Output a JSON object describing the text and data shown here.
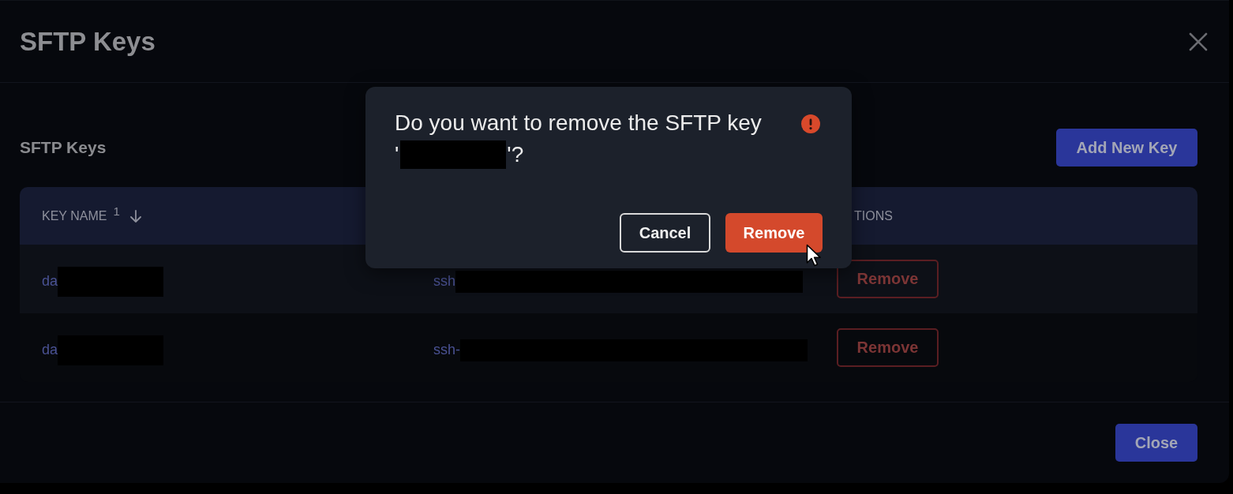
{
  "window": {
    "title": "SFTP Keys"
  },
  "section": {
    "title": "SFTP Keys",
    "add_button": "Add New Key"
  },
  "table": {
    "header": {
      "key_name": {
        "label": "KEY NAME",
        "sort_rank": "1",
        "sort_descending": true
      },
      "column_3": {
        "label": "TIONS"
      }
    },
    "rows": [
      {
        "key_name": {
          "text": "da",
          "redacted": true
        },
        "column_2": {
          "text": "ssh",
          "redacted": true
        },
        "action": "Remove"
      },
      {
        "key_name": {
          "text": "da",
          "redacted": true
        },
        "column_2": {
          "text": "ssh-",
          "redacted": true
        },
        "action": "Remove"
      }
    ]
  },
  "footer": {
    "close_button": "Close"
  },
  "confirm_dialog": {
    "message": "Do you want to remove the SFTP key",
    "quote_open": "'",
    "quote_close": "'?",
    "redacted": true,
    "warning": true,
    "buttons": [
      {
        "label": "Cancel",
        "kind": "secondary"
      },
      {
        "label": "Remove",
        "kind": "danger"
      }
    ]
  }
}
